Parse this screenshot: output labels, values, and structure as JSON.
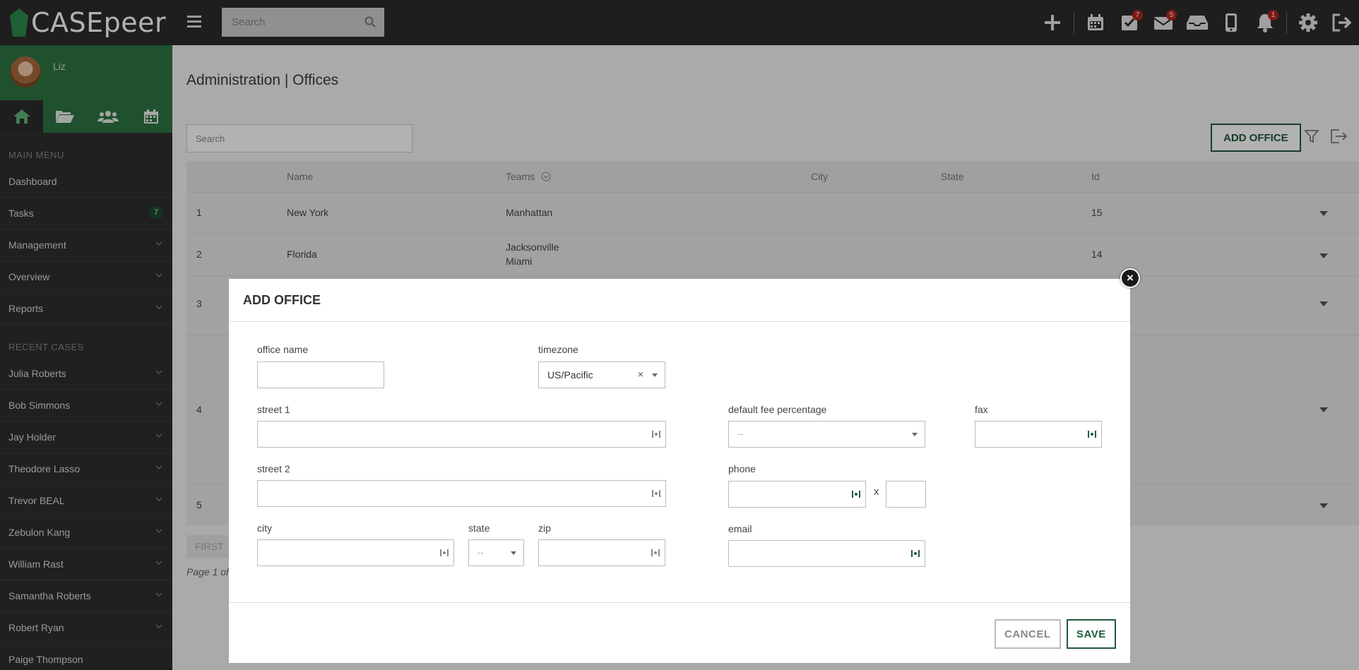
{
  "app": {
    "logo_text": "CASEpeer"
  },
  "topbar": {
    "search_placeholder": "Search",
    "icons": [
      {
        "name": "plus-icon",
        "badge": ""
      },
      {
        "name": "calendar-icon",
        "badge": ""
      },
      {
        "name": "tasks-check-icon",
        "badge": "7"
      },
      {
        "name": "mail-icon",
        "badge": "5"
      },
      {
        "name": "inbox-tray-icon",
        "badge": ""
      },
      {
        "name": "mobile-phone-icon",
        "badge": ""
      },
      {
        "name": "bell-icon",
        "badge": "1"
      },
      {
        "name": "gear-icon",
        "badge": ""
      },
      {
        "name": "sign-out-icon",
        "badge": ""
      }
    ]
  },
  "sidebar": {
    "user_name": "Liz",
    "main_menu_heading": "MAIN MENU",
    "main_menu": [
      {
        "label": "Dashboard",
        "badge": "",
        "chevron": false
      },
      {
        "label": "Tasks",
        "badge": "7",
        "chevron": false
      },
      {
        "label": "Management",
        "badge": "",
        "chevron": true
      },
      {
        "label": "Overview",
        "badge": "",
        "chevron": true
      },
      {
        "label": "Reports",
        "badge": "",
        "chevron": true
      }
    ],
    "recent_heading": "RECENT CASES",
    "recent_cases": [
      "Julia Roberts",
      "Bob Simmons",
      "Jay Holder",
      "Theodore Lasso",
      "Trevor BEAL",
      "Zebulon Kang",
      "William Rast",
      "Samantha Roberts",
      "Robert Ryan",
      "Paige Thompson"
    ]
  },
  "main": {
    "breadcrumb": "Administration | Offices",
    "search_placeholder": "Search",
    "add_office_label": "ADD OFFICE",
    "columns": {
      "name": "Name",
      "teams": "Teams",
      "city": "City",
      "state": "State",
      "id": "Id"
    },
    "rows": [
      {
        "num": "1",
        "name": "New York",
        "teams": [
          "Manhattan"
        ],
        "id": "15"
      },
      {
        "num": "2",
        "name": "Florida",
        "teams": [
          "Jacksonville",
          "Miami"
        ],
        "id": "14"
      },
      {
        "num": "3",
        "name": "",
        "teams": [],
        "id": ""
      },
      {
        "num": "4",
        "name": "",
        "teams": [],
        "id": ""
      },
      {
        "num": "5",
        "name": "",
        "teams": [],
        "id": ""
      }
    ],
    "pager_first": "FIRST",
    "page_info": "Page 1 of"
  },
  "modal": {
    "title": "ADD OFFICE",
    "office_name_label": "office name",
    "office_name_value": "",
    "timezone_label": "timezone",
    "timezone_value": "US/Pacific",
    "street1_label": "street 1",
    "street2_label": "street 2",
    "city_label": "city",
    "state_label": "state",
    "state_value": "--",
    "zip_label": "zip",
    "fee_label": "default fee percentage",
    "fee_value": "--",
    "fax_label": "fax",
    "phone_label": "phone",
    "ext_sep": "x",
    "email_label": "email",
    "cancel_label": "CANCEL",
    "save_label": "SAVE"
  },
  "colors": {
    "brand_green": "#2d7443",
    "accent_dark_green": "#1f5a3a",
    "badge_red": "#b9241e",
    "topbar": "#2b2b2b"
  }
}
